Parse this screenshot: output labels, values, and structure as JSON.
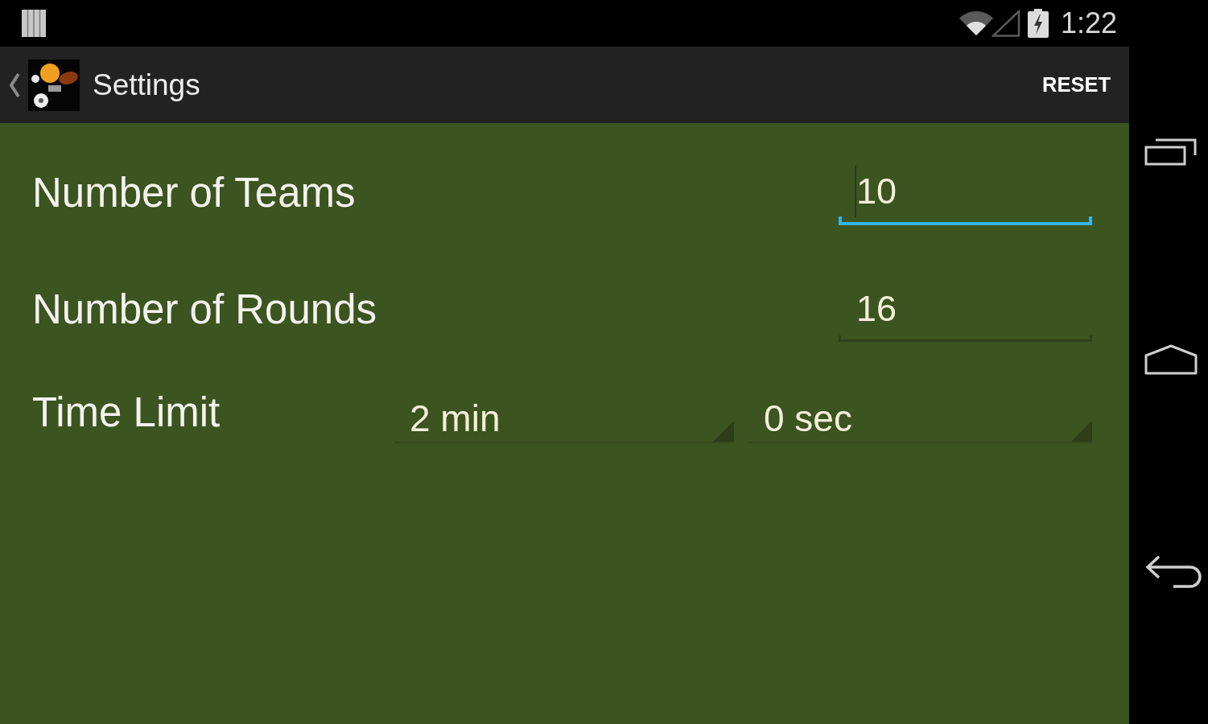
{
  "status_bar": {
    "time": "1:22"
  },
  "action_bar": {
    "title": "Settings",
    "action": "RESET"
  },
  "settings": [
    {
      "kind": "text_field",
      "label": "Number of Teams",
      "value": "10",
      "focused": true
    },
    {
      "kind": "text_field",
      "label": "Number of Rounds",
      "value": "16",
      "focused": false
    },
    {
      "kind": "spinners",
      "label": "Time Limit",
      "spinners": [
        {
          "value": "2 min"
        },
        {
          "value": "0 sec"
        }
      ]
    }
  ]
}
